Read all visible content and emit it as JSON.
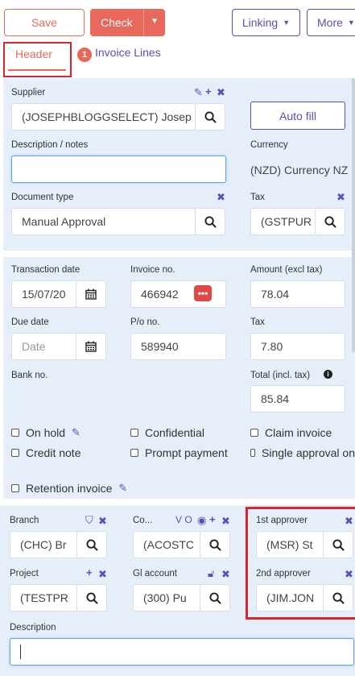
{
  "toolbar": {
    "save_label": "Save",
    "check_label": "Check",
    "linking_label": "Linking",
    "more_label": "More"
  },
  "tabs": {
    "header_label": "Header",
    "lines_badge": "1",
    "lines_label": "Invoice Lines"
  },
  "supplier": {
    "label": "Supplier",
    "value": "(JOSEPHBLOGGSELECT) Josep"
  },
  "autofill_label": "Auto fill",
  "description_notes": {
    "label": "Description / notes",
    "value": ""
  },
  "currency": {
    "label": "Currency",
    "value": "(NZD) Currency NZ"
  },
  "document_type": {
    "label": "Document type",
    "value": "Manual Approval"
  },
  "tax_code": {
    "label": "Tax",
    "value": "(GSTPUR"
  },
  "transaction_date": {
    "label": "Transaction date",
    "value": "15/07/20"
  },
  "invoice_no": {
    "label": "Invoice no.",
    "value": "466942"
  },
  "amount_excl_tax": {
    "label": "Amount (excl tax)",
    "value": "78.04"
  },
  "due_date": {
    "label": "Due date",
    "placeholder": "Date"
  },
  "po_no": {
    "label": "P/o no.",
    "value": "589940"
  },
  "tax_amount": {
    "label": "Tax",
    "value": "7.80"
  },
  "bank_no": {
    "label": "Bank no."
  },
  "total_incl_tax": {
    "label": "Total (incl. tax)",
    "value": "85.84"
  },
  "checkboxes": {
    "on_hold": "On hold",
    "confidential": "Confidential",
    "claim_invoice": "Claim invoice",
    "credit_note": "Credit note",
    "prompt_payment": "Prompt payment",
    "single_approval": "Single approval on",
    "retention_invoice": "Retention invoice"
  },
  "branch": {
    "label": "Branch",
    "value": "(CHC) Br"
  },
  "contact": {
    "label": "Co...",
    "value": "(ACOSTC",
    "vo": "V O"
  },
  "first_approver": {
    "label": "1st approver",
    "value": "(MSR) St"
  },
  "project": {
    "label": "Project",
    "value": "(TESTPR"
  },
  "gl_account": {
    "label": "Gl account",
    "value": "(300) Pu"
  },
  "second_approver": {
    "label": "2nd approver",
    "value": "(JIM.JON"
  },
  "description": {
    "label": "Description",
    "value": ""
  },
  "colors": {
    "accent": "#e8695b",
    "brand": "#5b4fb3",
    "panel": "#e6eef9",
    "highlight": "#d6262f"
  },
  "icons": [
    "search-icon",
    "calendar-icon",
    "edit-icon",
    "plus-icon",
    "close-icon",
    "pencil-icon",
    "info-icon",
    "shield-icon",
    "eye-icon",
    "unlock-icon",
    "more-dots-icon",
    "chevron-down-icon"
  ]
}
